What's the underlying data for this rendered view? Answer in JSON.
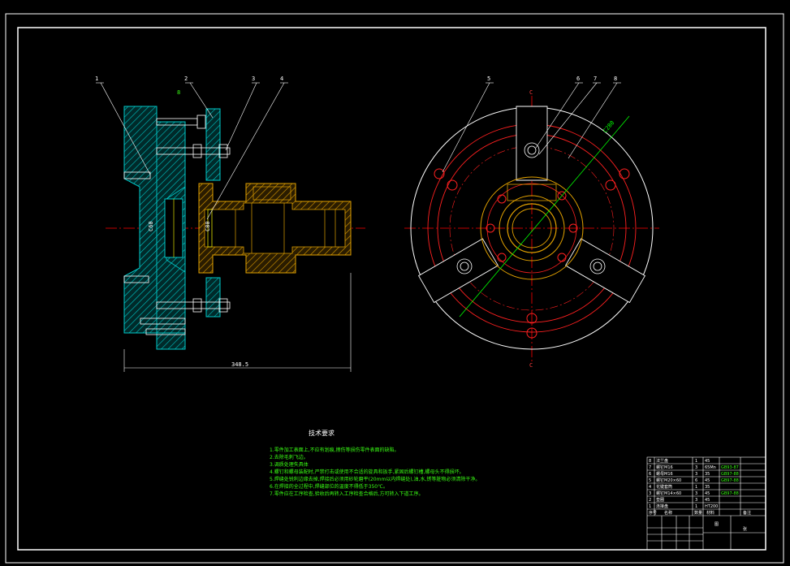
{
  "drawing": {
    "callouts": [
      "1",
      "2",
      "3",
      "4",
      "5",
      "6",
      "7",
      "8"
    ],
    "side_marks": [
      "8"
    ],
    "dimension_width": "348.5",
    "section_letters": [
      "C",
      "C",
      "C",
      "C"
    ],
    "angle_dim": "C280",
    "dim_left_vertical": "C60",
    "dim_left_vertical2": "C80"
  },
  "tech_requirements": {
    "title": "技术要求",
    "lines": [
      "1.零件加工表面上,不应有划痕,擦伤等损伤零件表面的缺陷。",
      "2.去除毛刺飞边。",
      "3.调质处理失具体",
      "4.螺钉和螺母装配时,严禁打击或使用不合适的旋具和扳手,紧固后螺钉槽,螺母头不得损坏。",
      "5.焊缝处锐利边缘去掉,焊接后必须用砂轮磨平(20mm以内焊缝处),油,水,锈等脏物必须清除干净。",
      "6.在焊接的全过程中,焊缝部位的温度不得低于350℃。",
      "7.零件应在工序检查,验收后再转入工序检查合格后,方可转入下道工序。"
    ]
  },
  "title_block": {
    "rows": [
      {
        "no": "8",
        "name": "法兰盘",
        "qty": "1",
        "mat": "45",
        "std": ""
      },
      {
        "no": "7",
        "name": "螺钉M16",
        "qty": "3",
        "mat": "65Mn",
        "std": "GB93-87"
      },
      {
        "no": "6",
        "name": "螺母M16",
        "qty": "3",
        "mat": "35",
        "std": "GB97-88"
      },
      {
        "no": "5",
        "name": "螺钉M20×60",
        "qty": "6",
        "mat": "45",
        "std": "GB97-88"
      },
      {
        "no": "4",
        "name": "花键套筒",
        "qty": "1",
        "mat": "35",
        "std": ""
      },
      {
        "no": "3",
        "name": "螺钉M14×60",
        "qty": "3",
        "mat": "45",
        "std": "GB97-88"
      },
      {
        "no": "2",
        "name": "垫圈",
        "qty": "3",
        "mat": "45",
        "std": ""
      },
      {
        "no": "1",
        "name": "连接盘",
        "qty": "1",
        "mat": "HT200",
        "std": ""
      }
    ],
    "header": {
      "no": "序号",
      "name": "名称",
      "qty": "数量",
      "mat": "材料",
      "note": "备注"
    },
    "drawing_name": "图",
    "sheet": "张"
  },
  "colors": {
    "background": "#000000",
    "frame": "#ffffff",
    "centerline": "#ff0000",
    "hatch_cyan": "#00c8c8",
    "hatch_yellow": "#e0a000",
    "text_green": "#39ff14",
    "dim_green": "#00ff00"
  }
}
